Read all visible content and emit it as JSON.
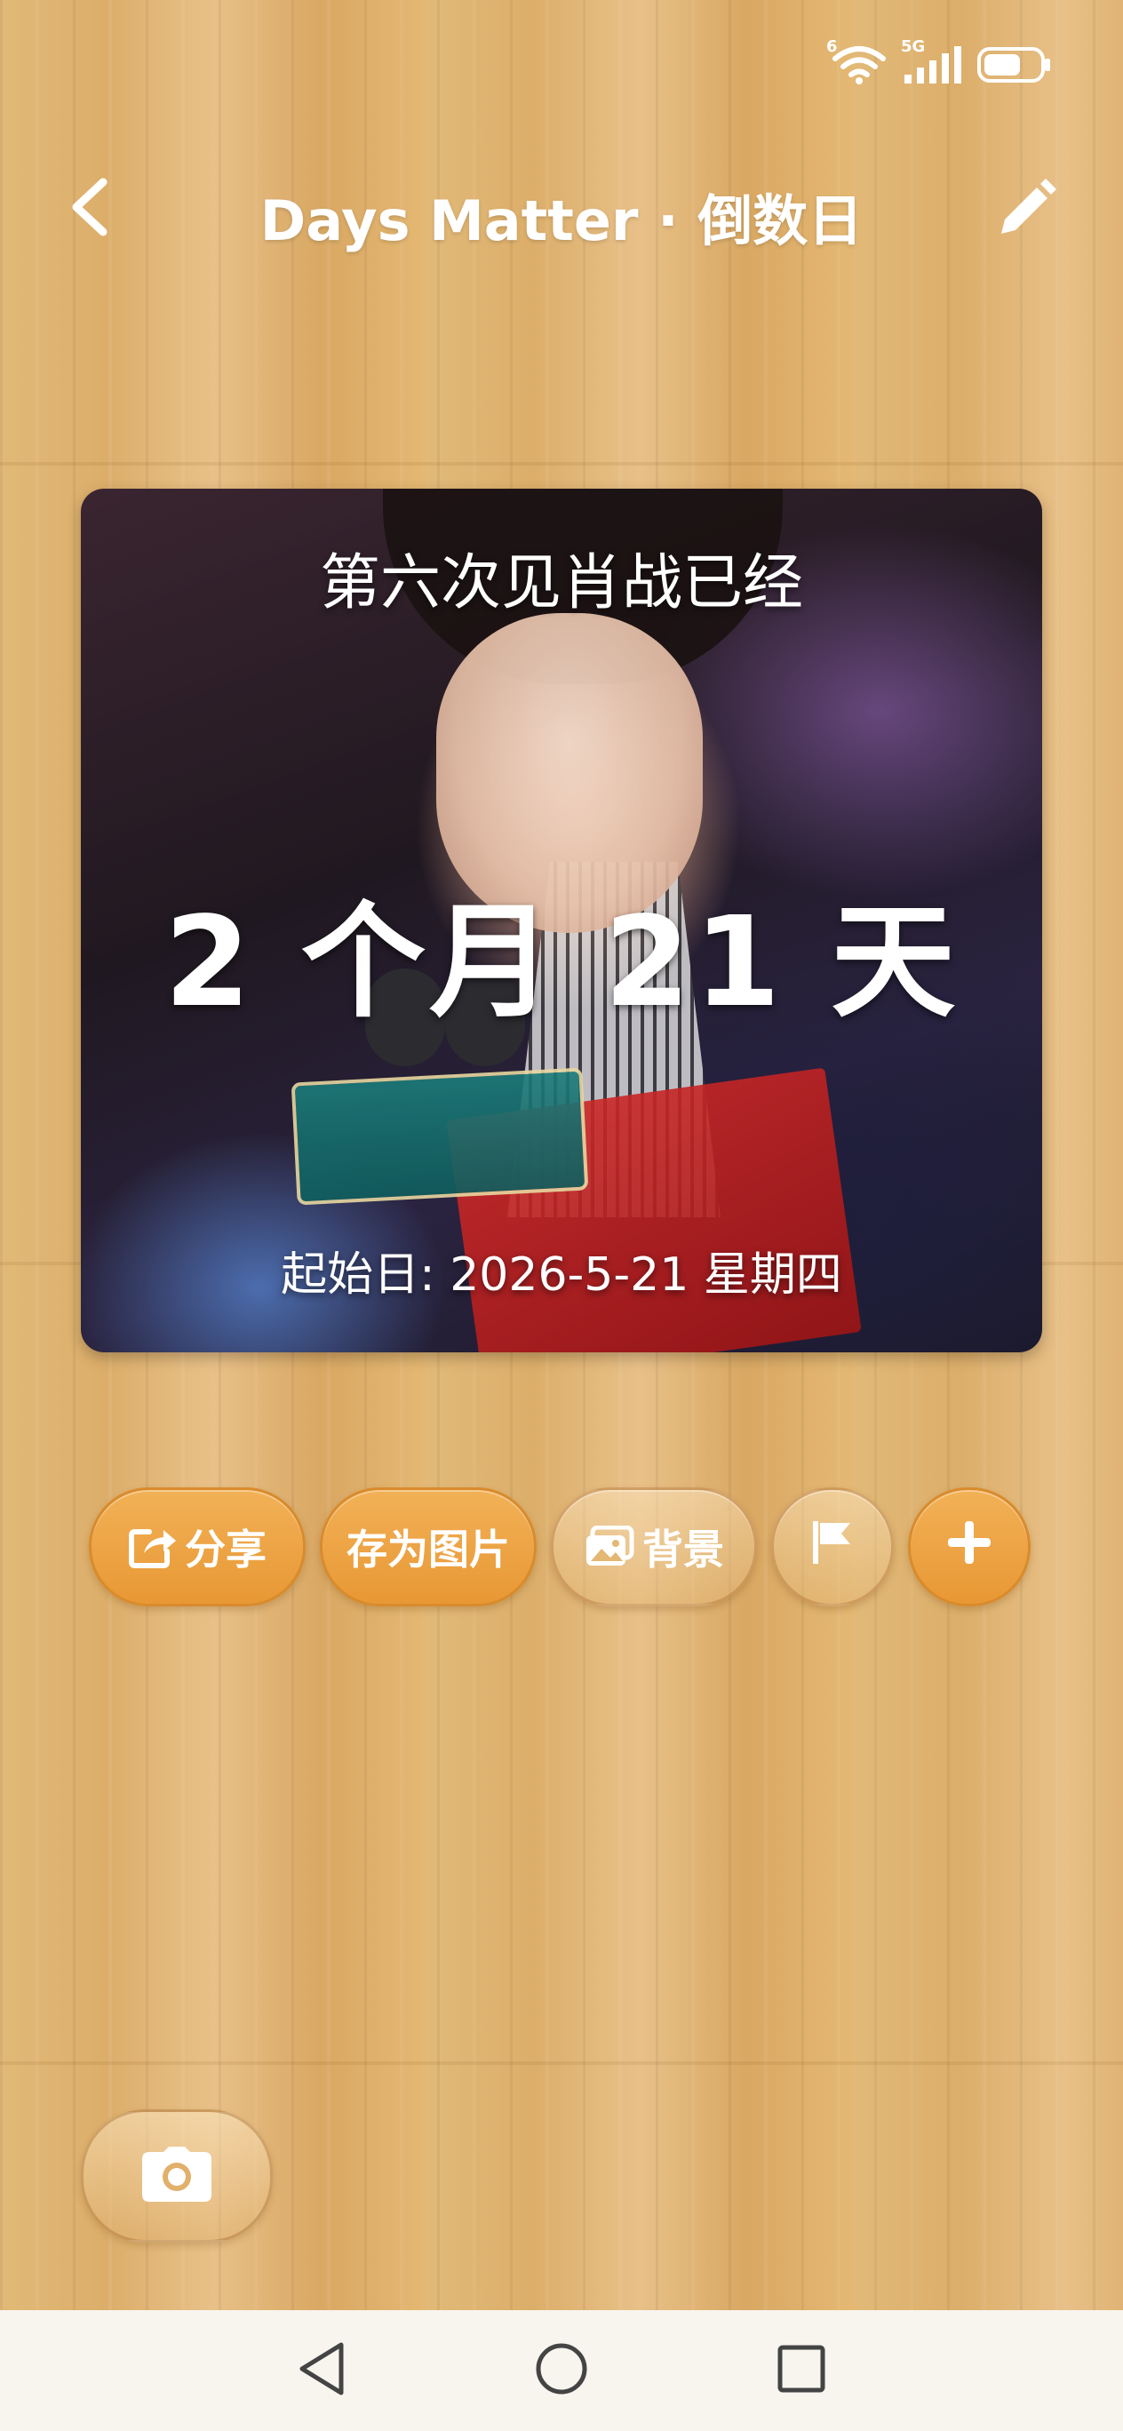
{
  "app": {
    "title": "Days Matter · 倒数日"
  },
  "status_bar": {
    "wifi_badge": "6",
    "network": "5G",
    "icons": [
      "wifi-icon",
      "signal-icon",
      "battery-icon"
    ]
  },
  "card": {
    "event_title": "第六次见肖战已经",
    "duration": "2 个月 21 天",
    "start_date": "起始日: 2026-5-21 星期四"
  },
  "actions": {
    "share_label": "分享",
    "save_image_label": "存为图片",
    "background_label": "背景",
    "flag_icon": "flag-icon",
    "add_icon": "plus-icon"
  },
  "colors": {
    "accent_orange": "#eea347",
    "nav_bg": "#f8f5ef"
  }
}
